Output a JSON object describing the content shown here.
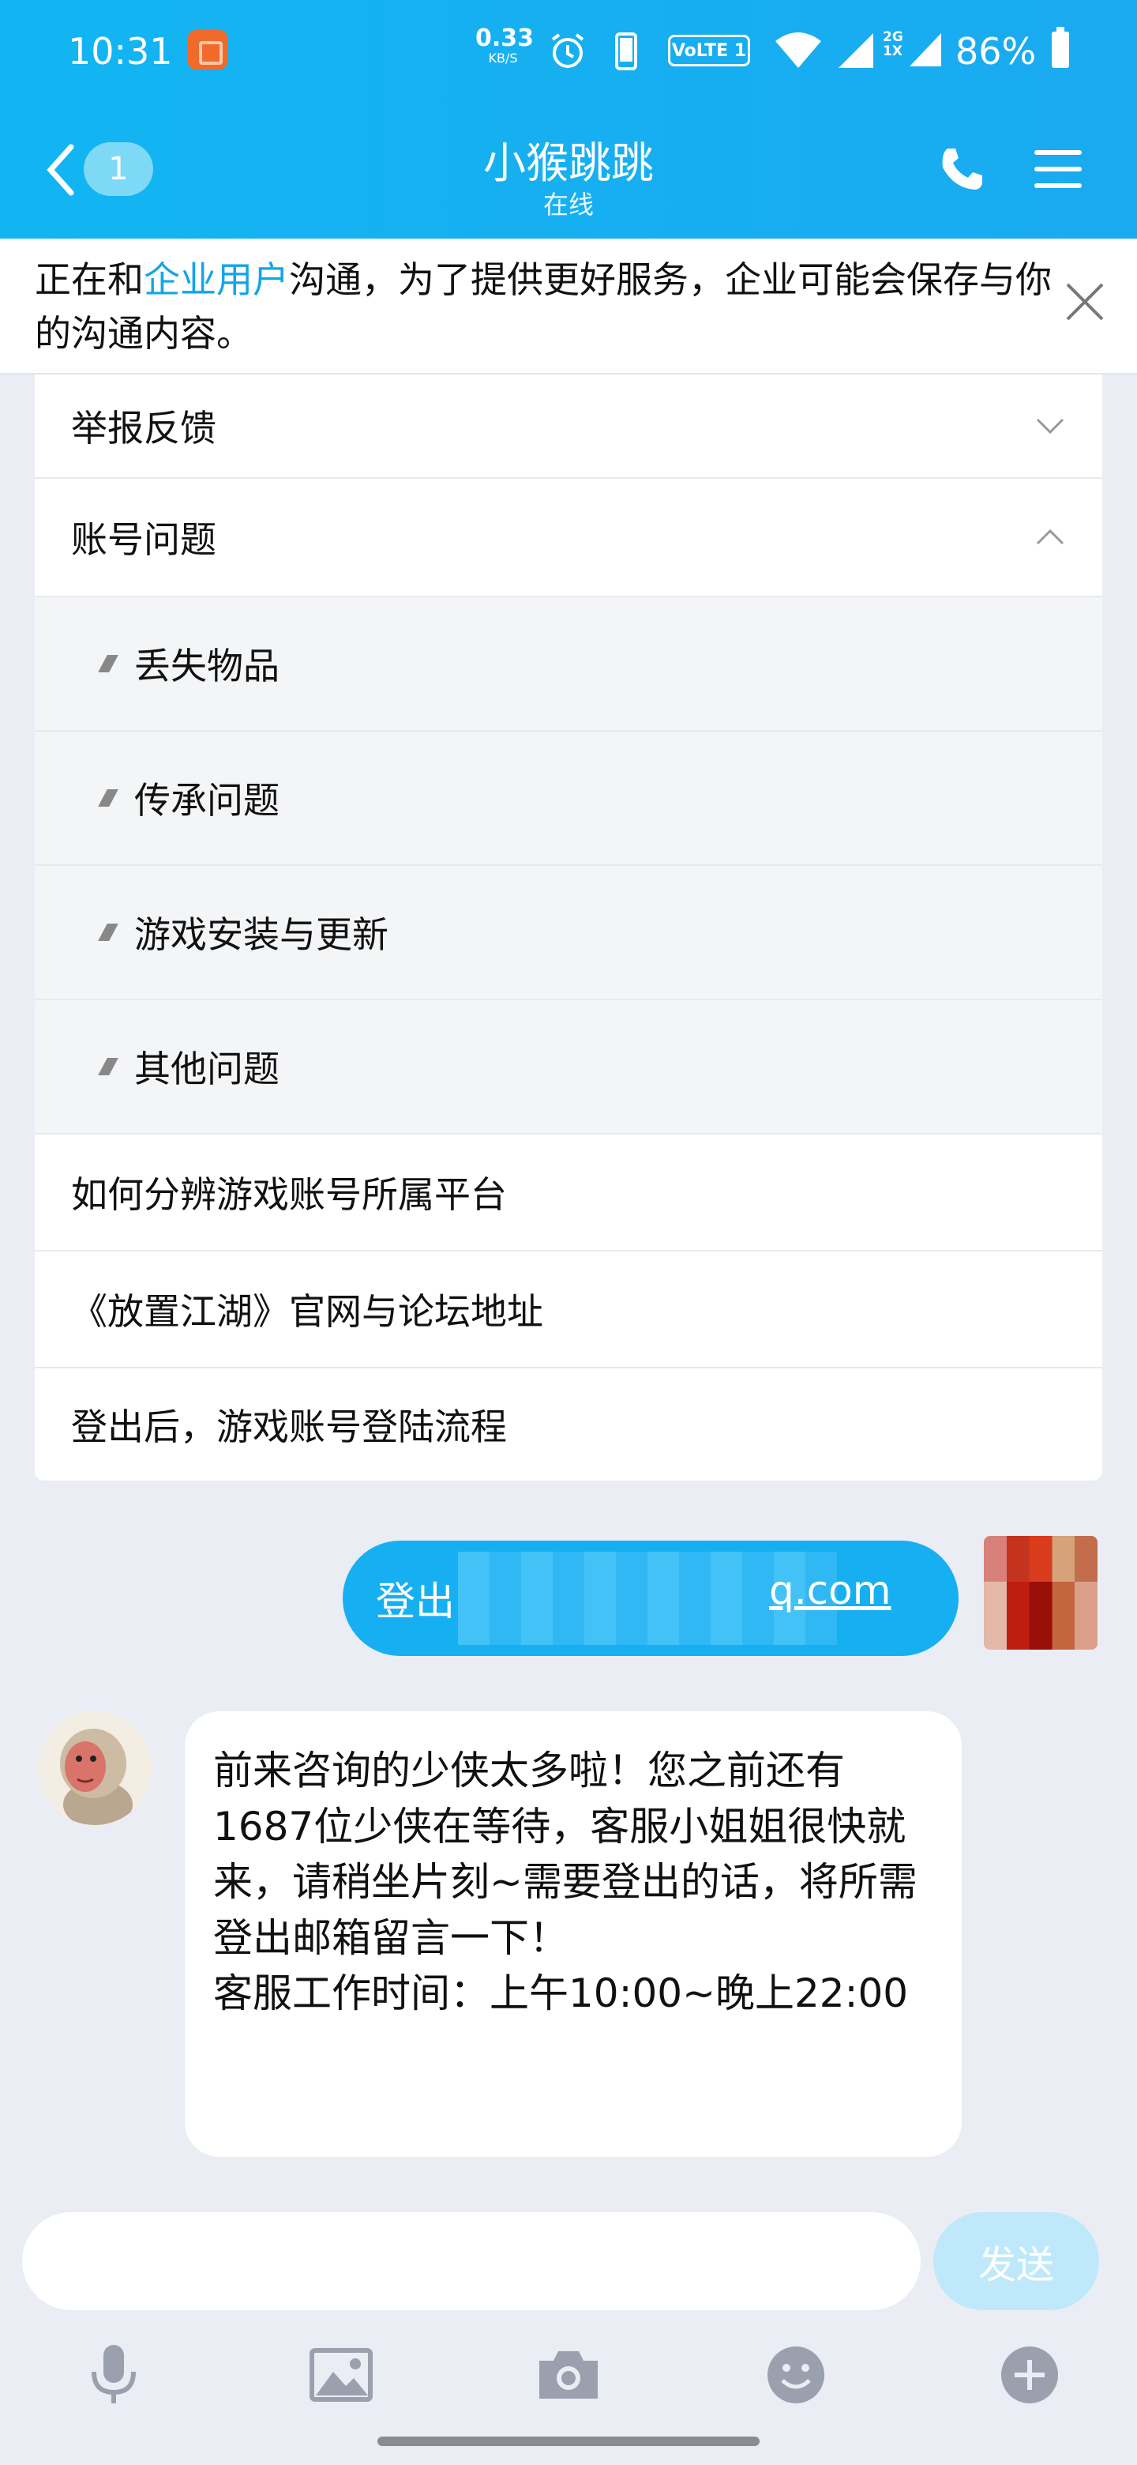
{
  "status_bar": {
    "time": "10:31",
    "net_speed_value": "0.33",
    "net_speed_unit": "KB/S",
    "volte": "VoLTE 1",
    "network_2g": "2G",
    "network_1x": "1X",
    "battery": "86%"
  },
  "header": {
    "unread_count": "1",
    "title": "小猴跳跳",
    "subtitle": "在线"
  },
  "notice": {
    "prefix": "正在和",
    "highlight": "企业用户",
    "suffix": "沟通，为了提供更好服务，企业可能会保存与你的沟通内容。"
  },
  "faq": {
    "items": [
      {
        "label": "举报反馈",
        "expanded": false
      },
      {
        "label": "账号问题",
        "expanded": true
      },
      {
        "label": "丢失物品",
        "sub": true
      },
      {
        "label": "传承问题",
        "sub": true
      },
      {
        "label": "游戏安装与更新",
        "sub": true
      },
      {
        "label": "其他问题",
        "sub": true
      },
      {
        "label": "如何分辨游戏账号所属平台"
      },
      {
        "label": "《放置江湖》官网与论坛地址"
      },
      {
        "label": "登出后，游戏账号登陆流程"
      }
    ]
  },
  "messages": {
    "sent_prefix": "登出",
    "sent_suffix": "q.com",
    "bot_reply": "前来咨询的少侠太多啦！您之前还有1687位少侠在等待，客服小姐姐很快就来，请稍坐片刻~需要登出的话，将所需登出邮箱留言一下！\n客服工作时间：上午10:00~晚上22:00"
  },
  "composer": {
    "placeholder": "",
    "send_label": "发送"
  },
  "toolbar": {
    "icons": [
      "microphone-icon",
      "image-icon",
      "camera-icon",
      "emoji-icon",
      "plus-icon"
    ]
  },
  "colors": {
    "header_blue": "#12b5f2",
    "accent_blue": "#16aff2",
    "link_blue": "#12a5e8",
    "send_disabled": "#bfe9fb"
  }
}
